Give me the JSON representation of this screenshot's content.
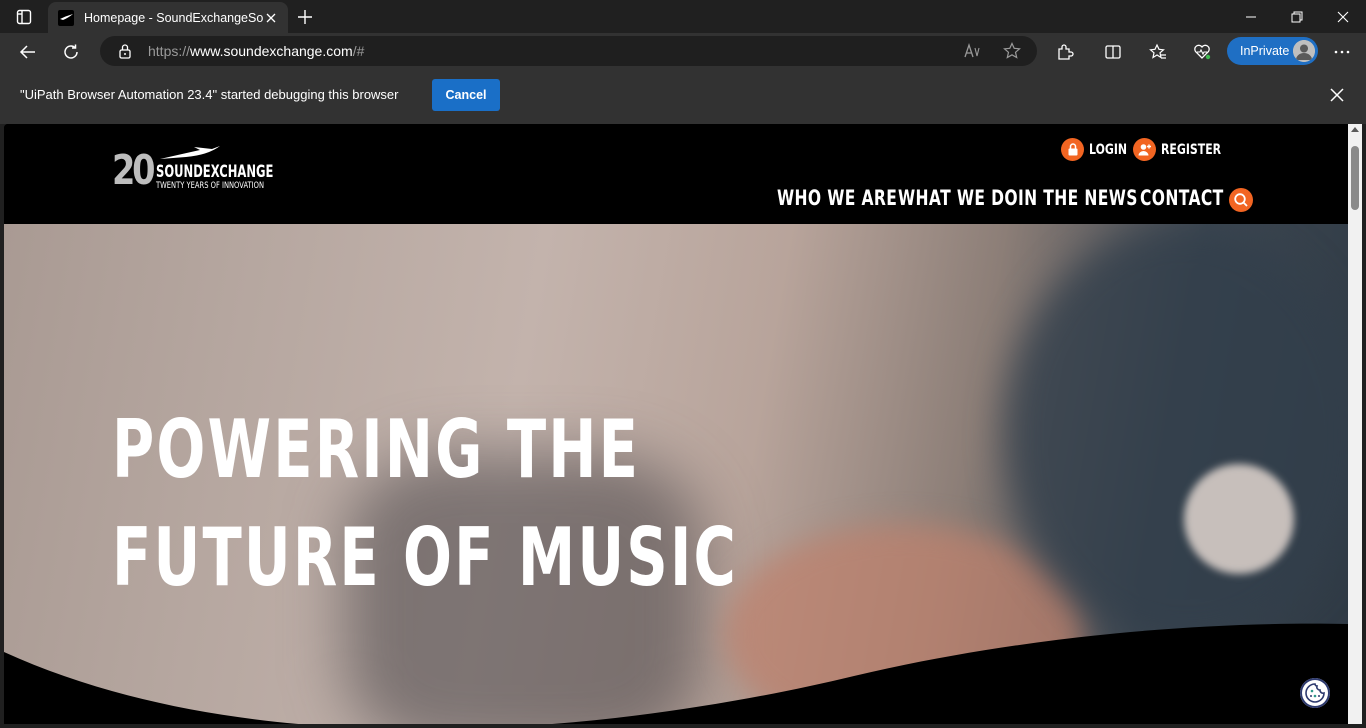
{
  "browser": {
    "tab_title": "Homepage - SoundExchangeSou",
    "url_scheme": "https://",
    "url_host": "www.soundexchange.com",
    "url_path": "/#",
    "inprivate_label": "InPrivate",
    "accent": "#1a6fc7"
  },
  "infobar": {
    "message": "\"UiPath Browser Automation 23.4\" started debugging this browser",
    "cancel_label": "Cancel"
  },
  "site": {
    "logo_number": "20",
    "logo_brand": "SOUNDEXCHANGE",
    "logo_tagline": "TWENTY YEARS OF INNOVATION",
    "login_label": "LOGIN",
    "register_label": "REGISTER",
    "nav": [
      "WHO WE ARE",
      "WHAT WE DO",
      "IN THE NEWS",
      "CONTACT"
    ],
    "hero_line1": "POWERING THE",
    "hero_line2": "FUTURE OF MUSIC",
    "brand_color": "#f26522",
    "icons": [
      "lock-icon",
      "add-user-icon",
      "search-icon",
      "cookie-icon"
    ]
  }
}
